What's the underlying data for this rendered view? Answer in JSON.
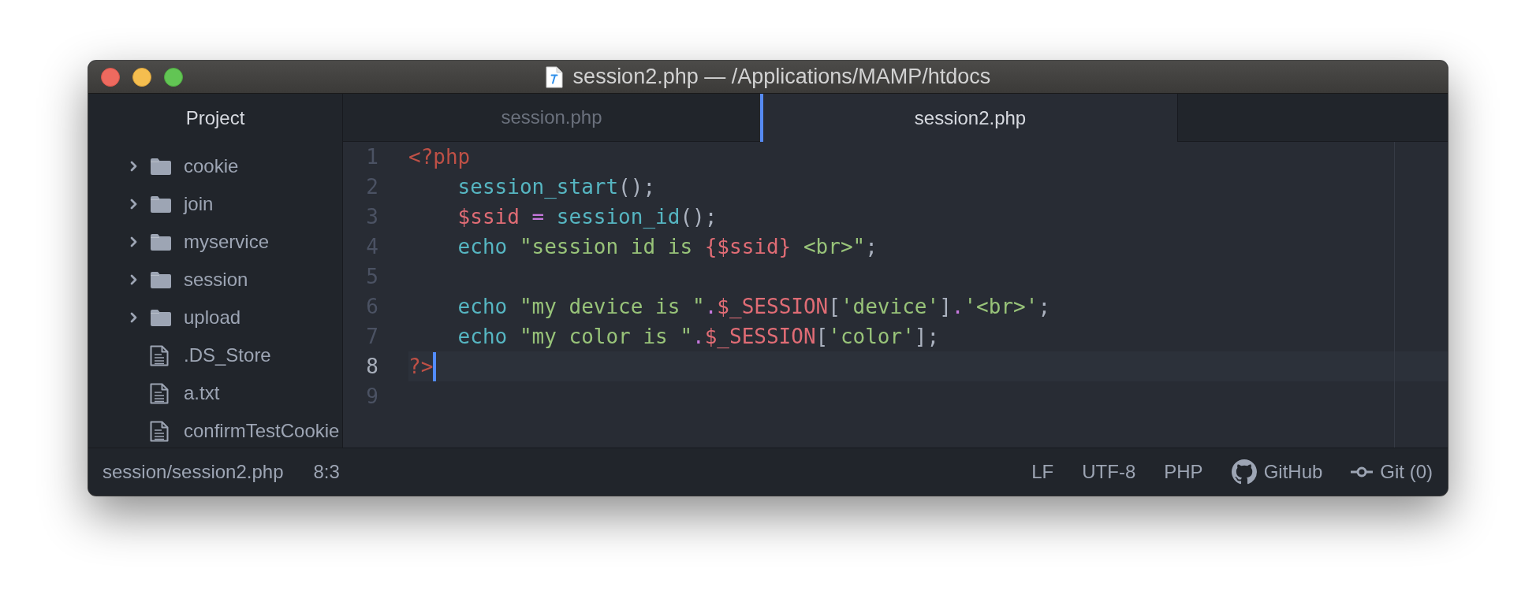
{
  "window": {
    "title": "session2.php — /Applications/MAMP/htdocs"
  },
  "sidebar": {
    "title": "Project",
    "items": [
      {
        "kind": "folder",
        "name": "cookie",
        "expanded": false,
        "selected": false
      },
      {
        "kind": "folder",
        "name": "join",
        "expanded": false,
        "selected": false
      },
      {
        "kind": "folder",
        "name": "myservice",
        "expanded": false,
        "selected": false
      },
      {
        "kind": "folder",
        "name": "session",
        "expanded": false,
        "selected": false
      },
      {
        "kind": "folder",
        "name": "upload",
        "expanded": false,
        "selected": false
      },
      {
        "kind": "file",
        "name": ".DS_Store",
        "selected": false
      },
      {
        "kind": "file",
        "name": "a.txt",
        "selected": false
      },
      {
        "kind": "file",
        "name": "confirmTestCookie",
        "selected": false
      }
    ]
  },
  "tabs": [
    {
      "label": "session.php",
      "selected": false
    },
    {
      "label": "session2.php",
      "selected": true
    }
  ],
  "editor": {
    "lines": [
      {
        "number": "1",
        "current": false,
        "tokens": [
          {
            "text": "<?php",
            "kind": "tag"
          }
        ]
      },
      {
        "number": "2",
        "current": false,
        "tokens": [
          {
            "text": "    session_start",
            "kind": "function"
          },
          {
            "text": "();",
            "kind": "punctuation"
          }
        ]
      },
      {
        "number": "3",
        "current": false,
        "tokens": [
          {
            "text": "    $ssid ",
            "kind": "variable"
          },
          {
            "text": "= ",
            "kind": "operator"
          },
          {
            "text": "session_id",
            "kind": "function"
          },
          {
            "text": "();",
            "kind": "punctuation"
          }
        ]
      },
      {
        "number": "4",
        "current": false,
        "tokens": [
          {
            "text": "    echo ",
            "kind": "function"
          },
          {
            "text": "\"session id is ",
            "kind": "string"
          },
          {
            "text": "{$ssid}",
            "kind": "variable"
          },
          {
            "text": " <br>\"",
            "kind": "string"
          },
          {
            "text": ";",
            "kind": "punctuation"
          }
        ]
      },
      {
        "number": "5",
        "current": false
      },
      {
        "number": "6",
        "current": false,
        "tokens": [
          {
            "text": "    echo ",
            "kind": "function"
          },
          {
            "text": "\"my device is \"",
            "kind": "string"
          },
          {
            "text": ".",
            "kind": "operator"
          },
          {
            "text": "$_SESSION",
            "kind": "variable"
          },
          {
            "text": "[",
            "kind": "punctuation"
          },
          {
            "text": "'device'",
            "kind": "string"
          },
          {
            "text": "]",
            "kind": "punctuation"
          },
          {
            "text": ".",
            "kind": "operator"
          },
          {
            "text": "'<br>'",
            "kind": "string"
          },
          {
            "text": ";",
            "kind": "punctuation"
          }
        ]
      },
      {
        "number": "7",
        "current": false,
        "tokens": [
          {
            "text": "    echo ",
            "kind": "function"
          },
          {
            "text": "\"my color is \"",
            "kind": "string"
          },
          {
            "text": ".",
            "kind": "operator"
          },
          {
            "text": "$_SESSION",
            "kind": "variable"
          },
          {
            "text": "[",
            "kind": "punctuation"
          },
          {
            "text": "'color'",
            "kind": "string"
          },
          {
            "text": "]",
            "kind": "punctuation"
          },
          {
            "text": ";",
            "kind": "punctuation"
          }
        ]
      },
      {
        "number": "8",
        "current": true,
        "tokens": [
          {
            "text": "?>",
            "kind": "tag"
          }
        ]
      },
      {
        "number": "9",
        "current": false
      }
    ]
  },
  "status_bar": {
    "file_path": "session/session2.php",
    "cursor_position": "8:3",
    "line_ending": "LF",
    "encoding": "UTF-8",
    "grammar": "PHP",
    "github": "GitHub",
    "git": "Git (0)"
  }
}
